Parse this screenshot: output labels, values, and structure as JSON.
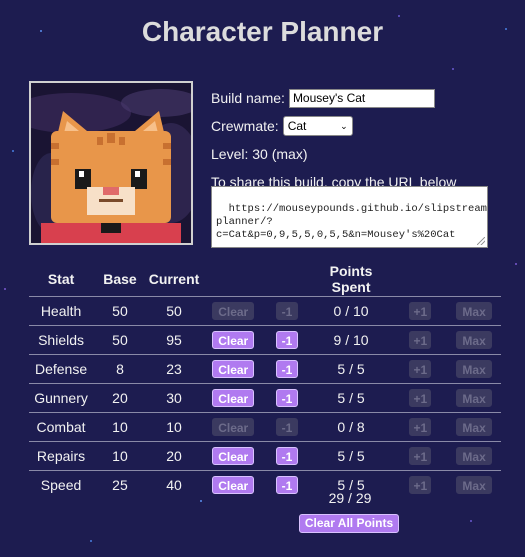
{
  "page": {
    "title": "Character Planner"
  },
  "portrait": {
    "alt": "Cat crew portrait"
  },
  "form": {
    "build_name_label": "Build name:",
    "build_name_value": "Mousey's Cat",
    "crewmate_label": "Crewmate:",
    "crewmate_value": "Cat",
    "level_text": "Level: 30 (max)",
    "share_text": "To share this build, copy the URL below",
    "url": "https://mouseypounds.github.io/slipstream-\nplanner/?\nc=Cat&p=0,9,5,5,0,5,5&n=Mousey's%20Cat"
  },
  "table": {
    "headers": {
      "stat": "Stat",
      "base": "Base",
      "current": "Current",
      "points": "Points Spent"
    },
    "buttons": {
      "clear": "Clear",
      "minus": "-1",
      "plus": "+1",
      "max": "Max"
    },
    "rows": [
      {
        "stat": "Health",
        "base": "50",
        "current": "50",
        "spent": "0 / 10",
        "dec_enabled": false
      },
      {
        "stat": "Shields",
        "base": "50",
        "current": "95",
        "spent": "9 / 10",
        "dec_enabled": true
      },
      {
        "stat": "Defense",
        "base": "8",
        "current": "23",
        "spent": "5 / 5",
        "dec_enabled": true
      },
      {
        "stat": "Gunnery",
        "base": "20",
        "current": "30",
        "spent": "5 / 5",
        "dec_enabled": true
      },
      {
        "stat": "Combat",
        "base": "10",
        "current": "10",
        "spent": "0 / 8",
        "dec_enabled": false
      },
      {
        "stat": "Repairs",
        "base": "10",
        "current": "20",
        "spent": "5 / 5",
        "dec_enabled": true
      },
      {
        "stat": "Speed",
        "base": "25",
        "current": "40",
        "spent": "5 / 5",
        "dec_enabled": true
      }
    ]
  },
  "footer": {
    "total": "29 / 29",
    "clear_all": "Clear All Points"
  },
  "colors": {
    "background": "#1d1c50",
    "accent": "#b07af0",
    "disabled": "#3b3a60"
  }
}
